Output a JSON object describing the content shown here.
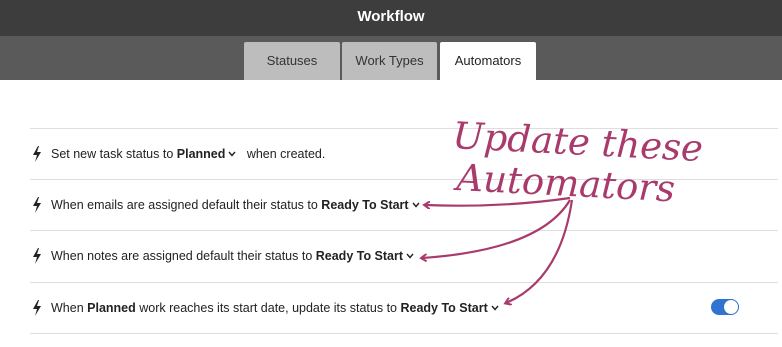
{
  "window": {
    "title": "Workflow"
  },
  "tabs": [
    {
      "label": "Statuses"
    },
    {
      "label": "Work Types"
    },
    {
      "label": "Automators",
      "active": true
    }
  ],
  "automators": [
    {
      "prefix": "Set new task status to ",
      "value": "Planned",
      "suffix": "when created."
    },
    {
      "prefix": "When emails are assigned default their status to ",
      "value": "Ready To Start"
    },
    {
      "prefix": "When notes are assigned default their status to ",
      "value": "Ready To Start"
    },
    {
      "prefix": "When ",
      "bold": "Planned",
      "middle": " work reaches its start date, update its status to ",
      "value": "Ready To Start",
      "toggle_on": true
    }
  ],
  "annotation": {
    "line1": "Update these",
    "line2": "Automators",
    "color": "#a83a6c"
  },
  "colors": {
    "titlebar": "#3d3d3d",
    "tabbar": "#5a5a5a",
    "tab_inactive": "#bdbdbd",
    "toggle_on": "#2f74d0"
  }
}
